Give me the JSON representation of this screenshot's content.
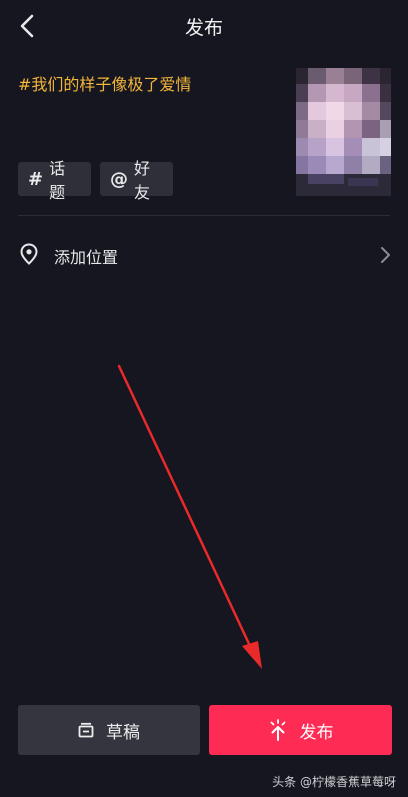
{
  "header": {
    "title": "发布"
  },
  "post": {
    "caption": "#我们的样子像极了爱情"
  },
  "chips": [
    {
      "symbol": "#",
      "label": "话题"
    },
    {
      "symbol": "@",
      "label": "好友"
    }
  ],
  "location": {
    "label": "添加位置"
  },
  "actions": {
    "draft_label": "草稿",
    "publish_label": "发布"
  },
  "watermark": "头条 @柠檬香蕉草莓呀",
  "colors": {
    "background": "#15161f",
    "caption": "#f3b43a",
    "publish": "#fe2c55",
    "arrow": "#e82a2a"
  }
}
